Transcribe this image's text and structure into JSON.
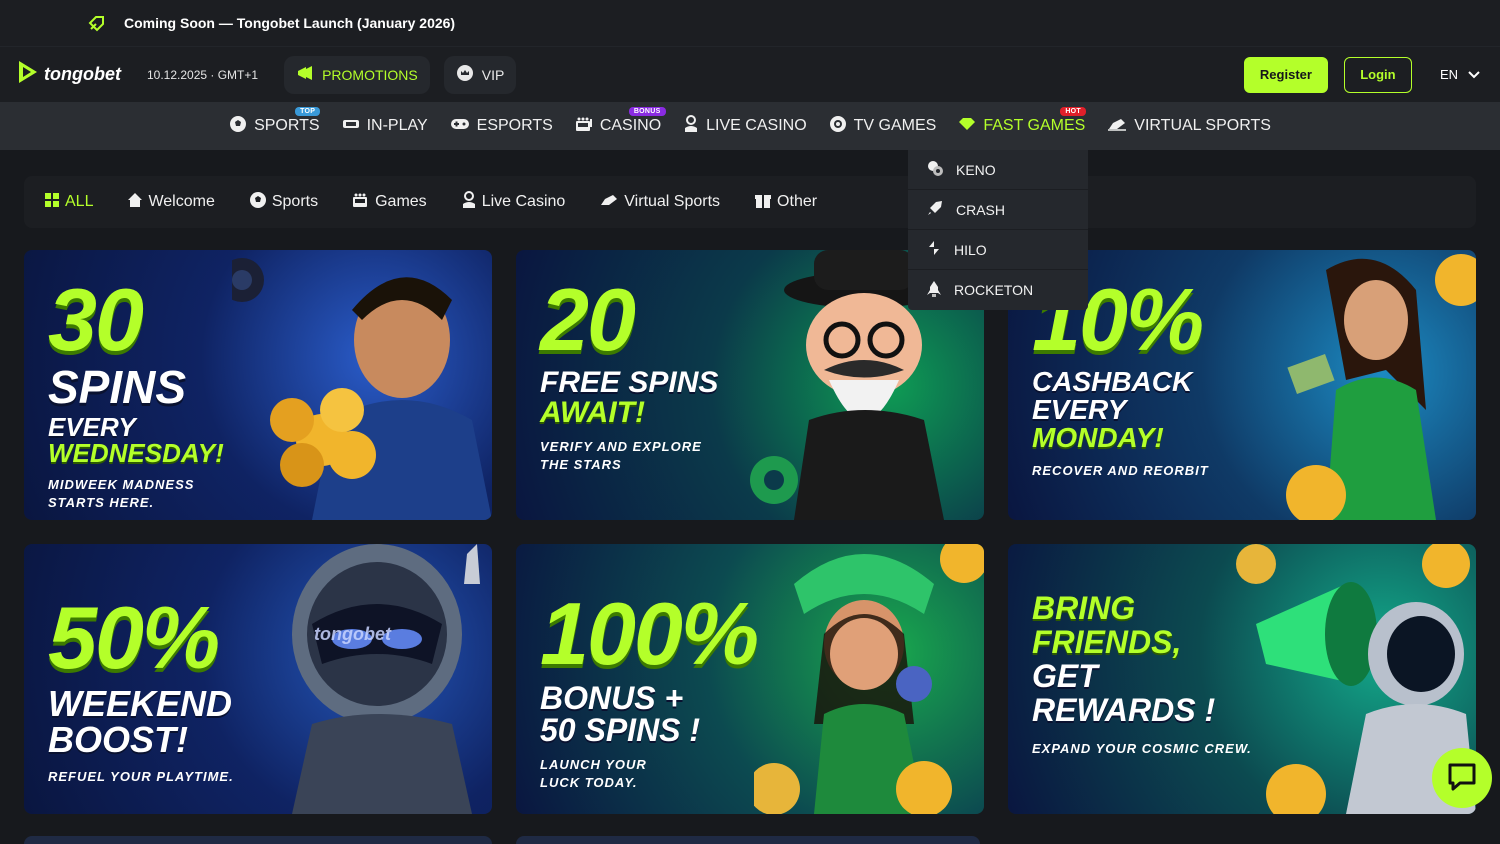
{
  "announcement": {
    "text": "Coming Soon — Tongobet Launch (January 2026)"
  },
  "header": {
    "logo_text": "tongobet",
    "datetime": "10.12.2025 · GMT+1",
    "promotions_label": "PROMOTIONS",
    "vip_label": "VIP",
    "register_label": "Register",
    "login_label": "Login",
    "language": "EN"
  },
  "nav": {
    "items": [
      {
        "label": "SPORTS",
        "badge": "TOP"
      },
      {
        "label": "IN-PLAY"
      },
      {
        "label": "ESPORTS"
      },
      {
        "label": "CASINO",
        "badge": "BONUS"
      },
      {
        "label": "LIVE CASINO"
      },
      {
        "label": "TV GAMES"
      },
      {
        "label": "FAST GAMES",
        "badge": "HOT",
        "active": true
      },
      {
        "label": "VIRTUAL SPORTS"
      }
    ]
  },
  "dropdown": {
    "items": [
      "KENO",
      "CRASH",
      "HILO",
      "ROCKETON"
    ]
  },
  "filters": {
    "items": [
      "ALL",
      "Welcome",
      "Sports",
      "Games",
      "Live Casino",
      "Virtual Sports",
      "Other"
    ]
  },
  "cards": [
    {
      "big": "30",
      "line1": "SPINS",
      "line2": "EVERY",
      "line3": "WEDNESDAY!",
      "sub1": "MIDWEEK MADNESS",
      "sub2": "STARTS HERE."
    },
    {
      "big": "20",
      "line1": "FREE SPINS",
      "line2": "AWAIT!",
      "sub1": "VERIFY AND EXPLORE",
      "sub2": "THE STARS"
    },
    {
      "big": "10%",
      "line1": "CASHBACK",
      "line2": "EVERY",
      "line3": "MONDAY!",
      "sub1": "RECOVER AND REORBIT"
    },
    {
      "big": "50%",
      "line1": "WEEKEND",
      "line2": "BOOST!",
      "sub1": "REFUEL YOUR PLAYTIME.",
      "helmet": "tongobet"
    },
    {
      "big": "100%",
      "line1": "BONUS +",
      "line2": "50 SPINS !",
      "sub1": "LAUNCH YOUR",
      "sub2": "LUCK TODAY."
    },
    {
      "line1": "BRING",
      "line2": "FRIENDS,",
      "line3": "GET",
      "line4": "REWARDS !",
      "sub1": "EXPAND YOUR COSMIC CREW."
    }
  ],
  "colors": {
    "accent": "#b4ff2a",
    "background": "#17191d",
    "nav": "#2b2e33"
  }
}
